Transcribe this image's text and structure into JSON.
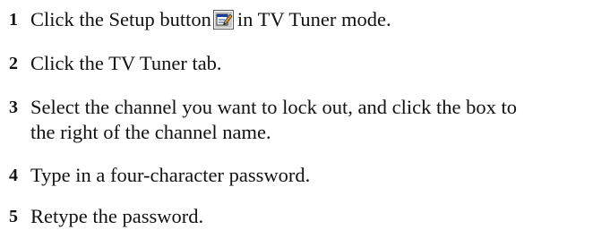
{
  "steps": [
    {
      "number": "1",
      "text_before_icon": "Click the Setup button",
      "icon": "setup-icon",
      "text_after_icon": "in TV Tuner mode."
    },
    {
      "number": "2",
      "text": "Click the TV Tuner tab."
    },
    {
      "number": "3",
      "line1": "Select the channel you want to lock out, and click the box to",
      "line2": "the right of the channel name."
    },
    {
      "number": "4",
      "text": "Type in a four-character password."
    },
    {
      "number": "5",
      "text": "Retype the password."
    }
  ]
}
